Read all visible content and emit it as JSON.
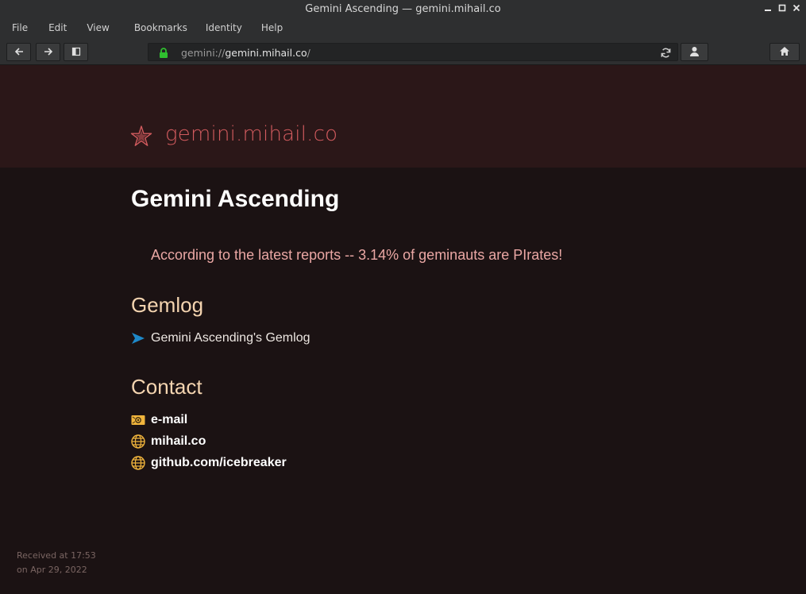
{
  "window": {
    "title": "Gemini Ascending — gemini.mihail.co",
    "controls": [
      "minimize-icon",
      "maximize-icon",
      "close-icon"
    ]
  },
  "menu": {
    "items": [
      "File",
      "Edit",
      "View",
      "Bookmarks",
      "Identity",
      "Help"
    ]
  },
  "toolbar": {
    "icons": [
      "back-arrow-icon",
      "forward-arrow-icon",
      "sidebar-toggle-icon",
      "lock-icon",
      "reload-icon",
      "identity-icon",
      "home-icon"
    ],
    "url_scheme": "gemini://",
    "url_host": "gemini.mihail.co",
    "url_path": "/"
  },
  "page": {
    "banner_title": "gemini.mihail.co",
    "heading": "Gemini Ascending",
    "quote": "According to the latest reports -- 3.14% of geminauts are PIrates!",
    "gemlog_heading": "Gemlog",
    "gemlog_link": "Gemini Ascending's Gemlog",
    "contact_heading": "Contact",
    "contact_links": [
      {
        "label": "e-mail",
        "icon": "email-icon"
      },
      {
        "label": "mihail.co",
        "icon": "globe-icon"
      },
      {
        "label": "github.com/icebreaker",
        "icon": "globe-icon"
      }
    ],
    "footer_line1": "Received at 17:53",
    "footer_line2": "on Apr 29, 2022"
  },
  "colors": {
    "background": "#1b1213",
    "banner": "#2b1718",
    "banner_title": "#d25b5e",
    "quote": "#eaa7a4",
    "subheading": "#f4d4b0",
    "link_arrow": "#1e88c8",
    "icon_yellow": "#f0b43c",
    "lock": "#2fbf2f"
  }
}
